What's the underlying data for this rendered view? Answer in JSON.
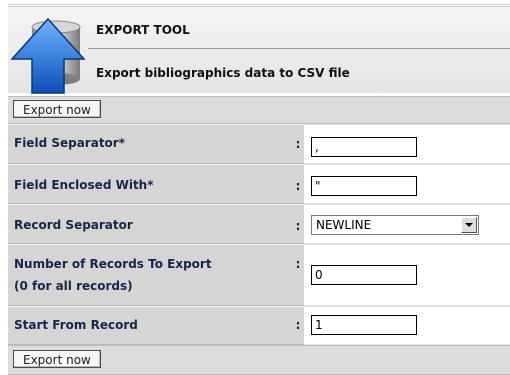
{
  "header": {
    "title": "EXPORT TOOL",
    "subtitle": "Export bibliographics data to CSV file",
    "icon": "export-upload-arrow-icon"
  },
  "buttons": {
    "export_top": "Export now",
    "export_bottom": "Export now"
  },
  "form": {
    "colon": ":",
    "field_separator": {
      "label": "Field Separator*",
      "value": ","
    },
    "field_enclosed": {
      "label": "Field Enclosed With*",
      "value": "\""
    },
    "record_separator": {
      "label": "Record Separator",
      "selected": "NEWLINE"
    },
    "num_records": {
      "label_line1": "Number of Records To Export",
      "label_line2": "(0 for all records)",
      "value": "0"
    },
    "start_from": {
      "label": "Start From Record",
      "value": "1"
    }
  },
  "colors": {
    "label_bg": "#d5d5d5",
    "label_text": "#16264a",
    "arrow_blue": "#1f6fd6"
  }
}
